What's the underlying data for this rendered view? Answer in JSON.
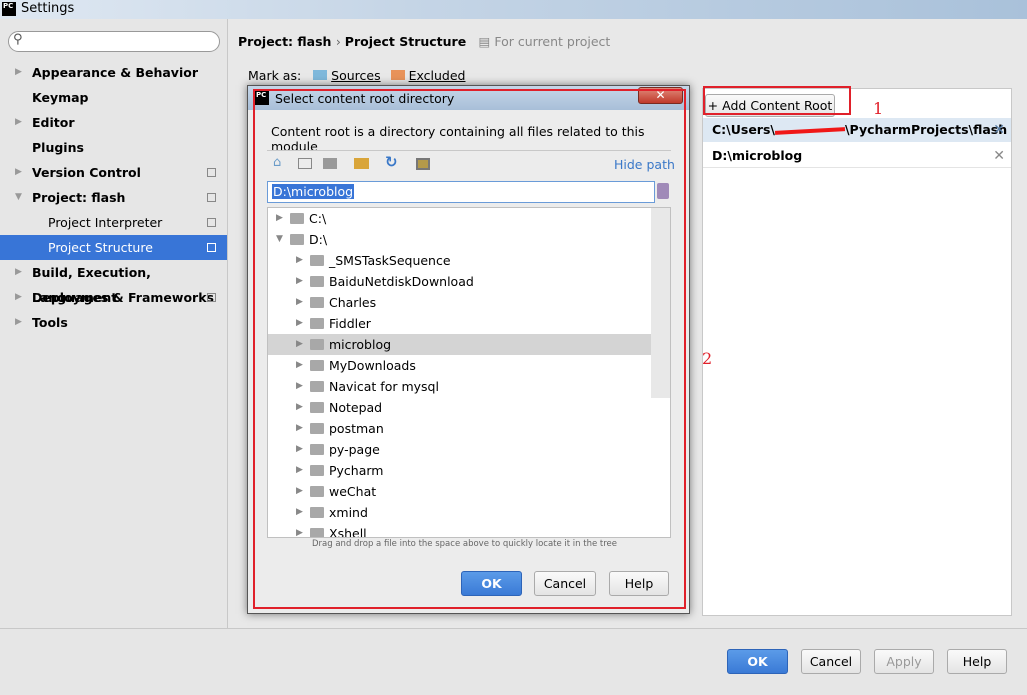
{
  "window": {
    "title": "Settings"
  },
  "sidebar": {
    "items": [
      {
        "label": "Appearance & Behavior",
        "arrow": true
      },
      {
        "label": "Keymap"
      },
      {
        "label": "Editor",
        "arrow": true
      },
      {
        "label": "Plugins"
      },
      {
        "label": "Version Control",
        "arrow": true,
        "cfg": true
      },
      {
        "label": "Project: flash",
        "arrow": "open",
        "cfg": true
      },
      {
        "label": "Project Interpreter",
        "sub": true,
        "cfg": true
      },
      {
        "label": "Project Structure",
        "sub": true,
        "cfg": true,
        "selected": true
      },
      {
        "label": "Build, Execution, Deployment",
        "arrow": true
      },
      {
        "label": "Languages & Frameworks",
        "arrow": true,
        "cfg": true
      },
      {
        "label": "Tools",
        "arrow": true
      }
    ]
  },
  "main": {
    "breadcrumb": [
      "Project: flash",
      "Project Structure"
    ],
    "scope": "For current project",
    "mark_as": "Mark as:",
    "sources": "Sources",
    "excluded": "Excluded",
    "add_root": "Add Content Root",
    "roots": [
      {
        "prefix": "C:\\Users\\",
        "suffix": "\\PycharmProjects\\flash",
        "selected": true
      },
      {
        "prefix": "D:\\microblog",
        "suffix": ""
      }
    ],
    "annotations": [
      "1",
      "2"
    ]
  },
  "dialog": {
    "title": "Select content root directory",
    "description": "Content root is a directory containing all files related to this module",
    "hide_path": "Hide path",
    "path": "D:\\microblog",
    "drives": [
      "C:\\",
      "D:\\"
    ],
    "folders": [
      "_SMSTaskSequence",
      "BaiduNetdiskDownload",
      "Charles",
      "Fiddler",
      "microblog",
      "MyDownloads",
      "Navicat for mysql",
      "Notepad",
      "postman",
      "py-page",
      "Pycharm",
      "weChat",
      "xmind",
      "Xshell"
    ],
    "selected_folder": "microblog",
    "hint": "Drag and drop a file into the space above to quickly locate it in the tree",
    "ok": "OK",
    "cancel": "Cancel",
    "help": "Help"
  },
  "footer": {
    "ok": "OK",
    "cancel": "Cancel",
    "apply": "Apply",
    "help": "Help"
  },
  "colors": {
    "accent": "#3875d7",
    "annotation": "#e0202a"
  }
}
